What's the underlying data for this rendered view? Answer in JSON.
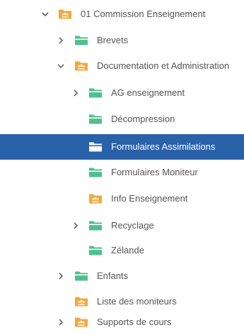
{
  "tree": {
    "items": [
      {
        "label": "01 Commission Enseignement",
        "type": "group-folder",
        "expander": "expanded",
        "selected": false
      },
      {
        "label": "Brevets",
        "type": "folder",
        "expander": "collapsed",
        "selected": false
      },
      {
        "label": "Documentation et Administration",
        "type": "group-folder",
        "expander": "expanded",
        "selected": false
      },
      {
        "label": "AG enseignement",
        "type": "folder",
        "expander": "collapsed",
        "selected": false
      },
      {
        "label": "Décompression",
        "type": "folder",
        "expander": "none",
        "selected": false
      },
      {
        "label": "Formulaires Assimilations",
        "type": "folder",
        "expander": "none",
        "selected": true
      },
      {
        "label": "Formulaires Moniteur",
        "type": "folder",
        "expander": "none",
        "selected": false
      },
      {
        "label": "Info Enseignement",
        "type": "group-folder",
        "expander": "none",
        "selected": false
      },
      {
        "label": "Recyclage",
        "type": "folder",
        "expander": "collapsed",
        "selected": false
      },
      {
        "label": "Zélande",
        "type": "folder",
        "expander": "none",
        "selected": false
      },
      {
        "label": "Enfants",
        "type": "folder",
        "expander": "collapsed",
        "selected": false
      },
      {
        "label": "Liste des moniteurs",
        "type": "group-folder",
        "expander": "none",
        "selected": false
      },
      {
        "label": "Supports de cours",
        "type": "group-folder",
        "expander": "collapsed",
        "selected": false
      }
    ]
  },
  "colors": {
    "selection": "#2a62a9",
    "folder_green": "#4fbf8f",
    "group_orange": "#f4a73a",
    "text": "#555555",
    "chevron": "#666666"
  }
}
